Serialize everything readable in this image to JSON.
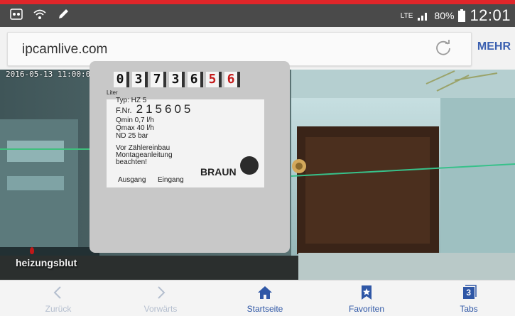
{
  "status_bar": {
    "left_icons": [
      "gallery-icon",
      "wifi-icon",
      "pen-icon"
    ],
    "network": "LTE",
    "battery": "80%",
    "time": "12:01"
  },
  "browser": {
    "url": "ipcamlive.com",
    "menu_label": "MEHR"
  },
  "camera": {
    "timestamp": "2016-05-13 11:00:00",
    "counter_digits": [
      "0",
      "3",
      "7",
      "3",
      "6",
      "5",
      "6"
    ],
    "counter_red_from_index": 5,
    "label_lines": {
      "liter": "Liter",
      "typ": "Typ: HZ 5",
      "fnr_prefix": "F.Nr.",
      "fnr": "215605",
      "qmin": "Qmin 0,7 l/h",
      "qmax": "Qmax 40 l/h",
      "nd": "ND 25 bar",
      "note1": "Vor Zählereinbau",
      "note2": "Montageanleitung",
      "note3": "beachten!",
      "ausgang": "Ausgang",
      "eingang": "Eingang",
      "brand": "BRAUN"
    },
    "watermark": "heizungsblut"
  },
  "nav": {
    "back": "Zurück",
    "forward": "Vorwärts",
    "home": "Startseite",
    "favorites": "Favoriten",
    "tabs": "Tabs",
    "tabs_count": "3"
  },
  "colors": {
    "status_red": "#e0262a",
    "accent_blue": "#2f57a6",
    "disabled": "#b5bfcf"
  }
}
